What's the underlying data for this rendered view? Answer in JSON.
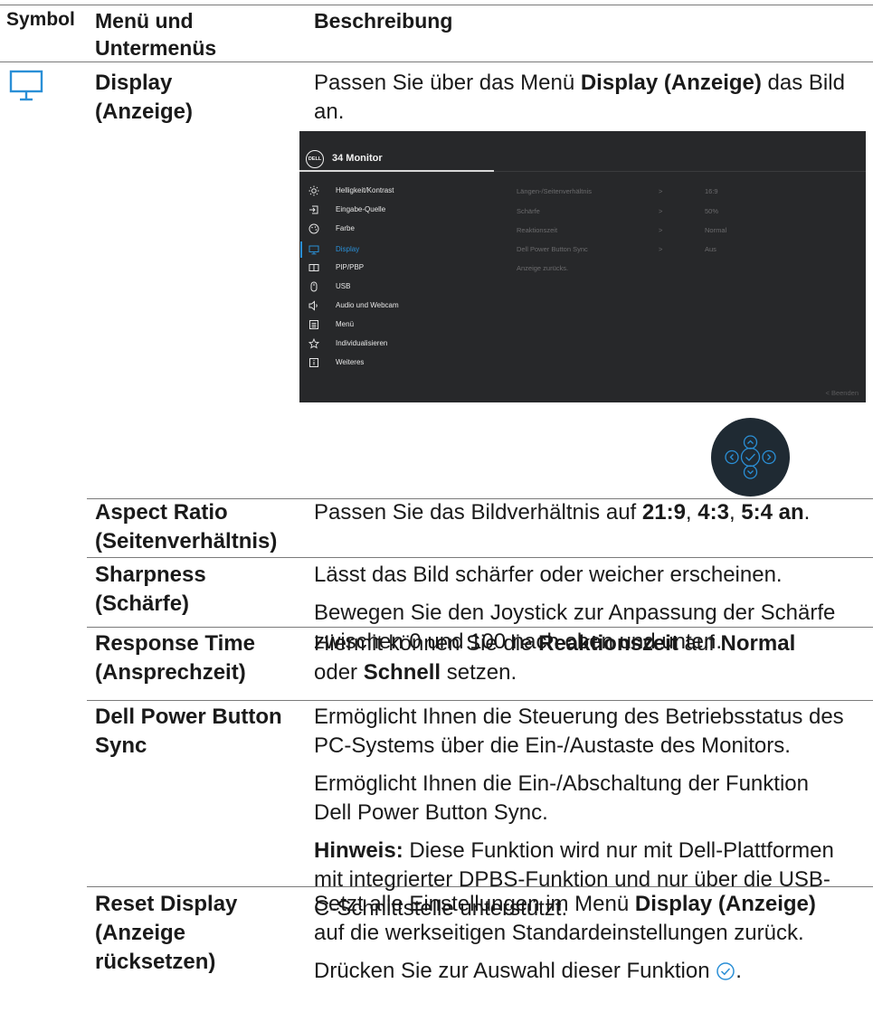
{
  "header": {
    "col_symbol": "Symbol",
    "col_menu_line1": "Menü und",
    "col_menu_line2": "Untermenüs",
    "col_desc": "Beschreibung"
  },
  "display_row": {
    "icon": "monitor-icon",
    "menu_line1": "Display",
    "menu_line2": "(Anzeige)",
    "desc_pre": "Passen Sie über das Menü ",
    "desc_bold": "Display (Anzeige)",
    "desc_post": " das Bild",
    "desc_line2": "an."
  },
  "osd": {
    "logo": "DELL",
    "title": "34 Monitor",
    "menu_items": [
      {
        "label": "Helligkeit/Kontrast",
        "icon": "brightness-icon"
      },
      {
        "label": "Eingabe-Quelle",
        "icon": "input-source-icon"
      },
      {
        "label": "Farbe",
        "icon": "color-palette-icon"
      },
      {
        "label": "Display",
        "icon": "display-icon"
      },
      {
        "label": "PIP/PBP",
        "icon": "pip-pbp-icon"
      },
      {
        "label": "USB",
        "icon": "usb-mouse-icon"
      },
      {
        "label": "Audio und Webcam",
        "icon": "speaker-icon"
      },
      {
        "label": "Menü",
        "icon": "menu-icon"
      },
      {
        "label": "Individualisieren",
        "icon": "star-icon"
      },
      {
        "label": "Weiteres",
        "icon": "info-icon"
      }
    ],
    "active_index": 3,
    "submenu": [
      {
        "label": "Längen-/Seitenverhältnis",
        "arrow": ">",
        "value": "16:9"
      },
      {
        "label": "Schärfe",
        "arrow": ">",
        "value": "50%"
      },
      {
        "label": "Reaktionszeit",
        "arrow": ">",
        "value": "Normal"
      },
      {
        "label": "Dell Power Button Sync",
        "arrow": ">",
        "value": "Aus"
      },
      {
        "label": "Anzeige zurücks.",
        "arrow": "",
        "value": ""
      }
    ],
    "exit": "<  Beenden"
  },
  "rows": {
    "aspect": {
      "name1": "Aspect Ratio",
      "name2": "(Seitenverhältnis)",
      "d_pre": "Passen Sie das Bildverhältnis auf ",
      "d_b1": "21:9",
      "d_sep1": ", ",
      "d_b2": "4:3",
      "d_sep2": ", ",
      "d_b3": "5:4 an",
      "d_end": "."
    },
    "sharpness": {
      "name1": "Sharpness",
      "name2": "(Schärfe)",
      "p1": "Lässt das Bild schärfer oder weicher erscheinen.",
      "p2_l1": "Bewegen Sie den Joystick zur Anpassung der Schärfe",
      "p2_l2": "zwischen 0 und 100 nach oben und unten."
    },
    "response": {
      "name1": "Response Time",
      "name2": "(Ansprechzeit)",
      "l1_pre": "Hiermit können Sie die ",
      "l1_b1": "Reaktionszeit",
      "l1_mid": " auf ",
      "l1_b2": "Normal",
      "l2_b": "oder ",
      "l2_b2": "Schnell",
      "l2_post": " setzen."
    },
    "dpbs": {
      "name1": "Dell Power Button",
      "name2": "Sync",
      "p1_l1": "Ermöglicht Ihnen die Steuerung des Betriebsstatus des",
      "p1_l2": "PC-Systems über die Ein-/Austaste des Monitors.",
      "p2_l1": "Ermöglicht Ihnen die Ein-/Abschaltung der Funktion",
      "p2_l2": "Dell Power Button Sync.",
      "note_b": "Hinweis:",
      "note_l1": " Diese Funktion wird nur mit Dell-Plattformen",
      "note_l2": "mit integrierter DPBS-Funktion und nur über die USB-",
      "note_l3": "C-Schnittstelle unterstützt."
    },
    "reset": {
      "name1": "Reset Display",
      "name2": "(Anzeige",
      "name3": "rücksetzen)",
      "l1_pre": "Setzt alle Einstellungen im Menü ",
      "l1_b": "Display (Anzeige)",
      "l2": "auf die werkseitigen Standardeinstellungen zurück.",
      "l3": "Drücken Sie zur Auswahl dieser Funktion ",
      "l3_icon": "check-circle-icon",
      "l3_end": "."
    }
  },
  "colors": {
    "accent_blue": "#2a8fd6",
    "osd_bg": "#27282a",
    "rule": "#7a7a7a"
  }
}
